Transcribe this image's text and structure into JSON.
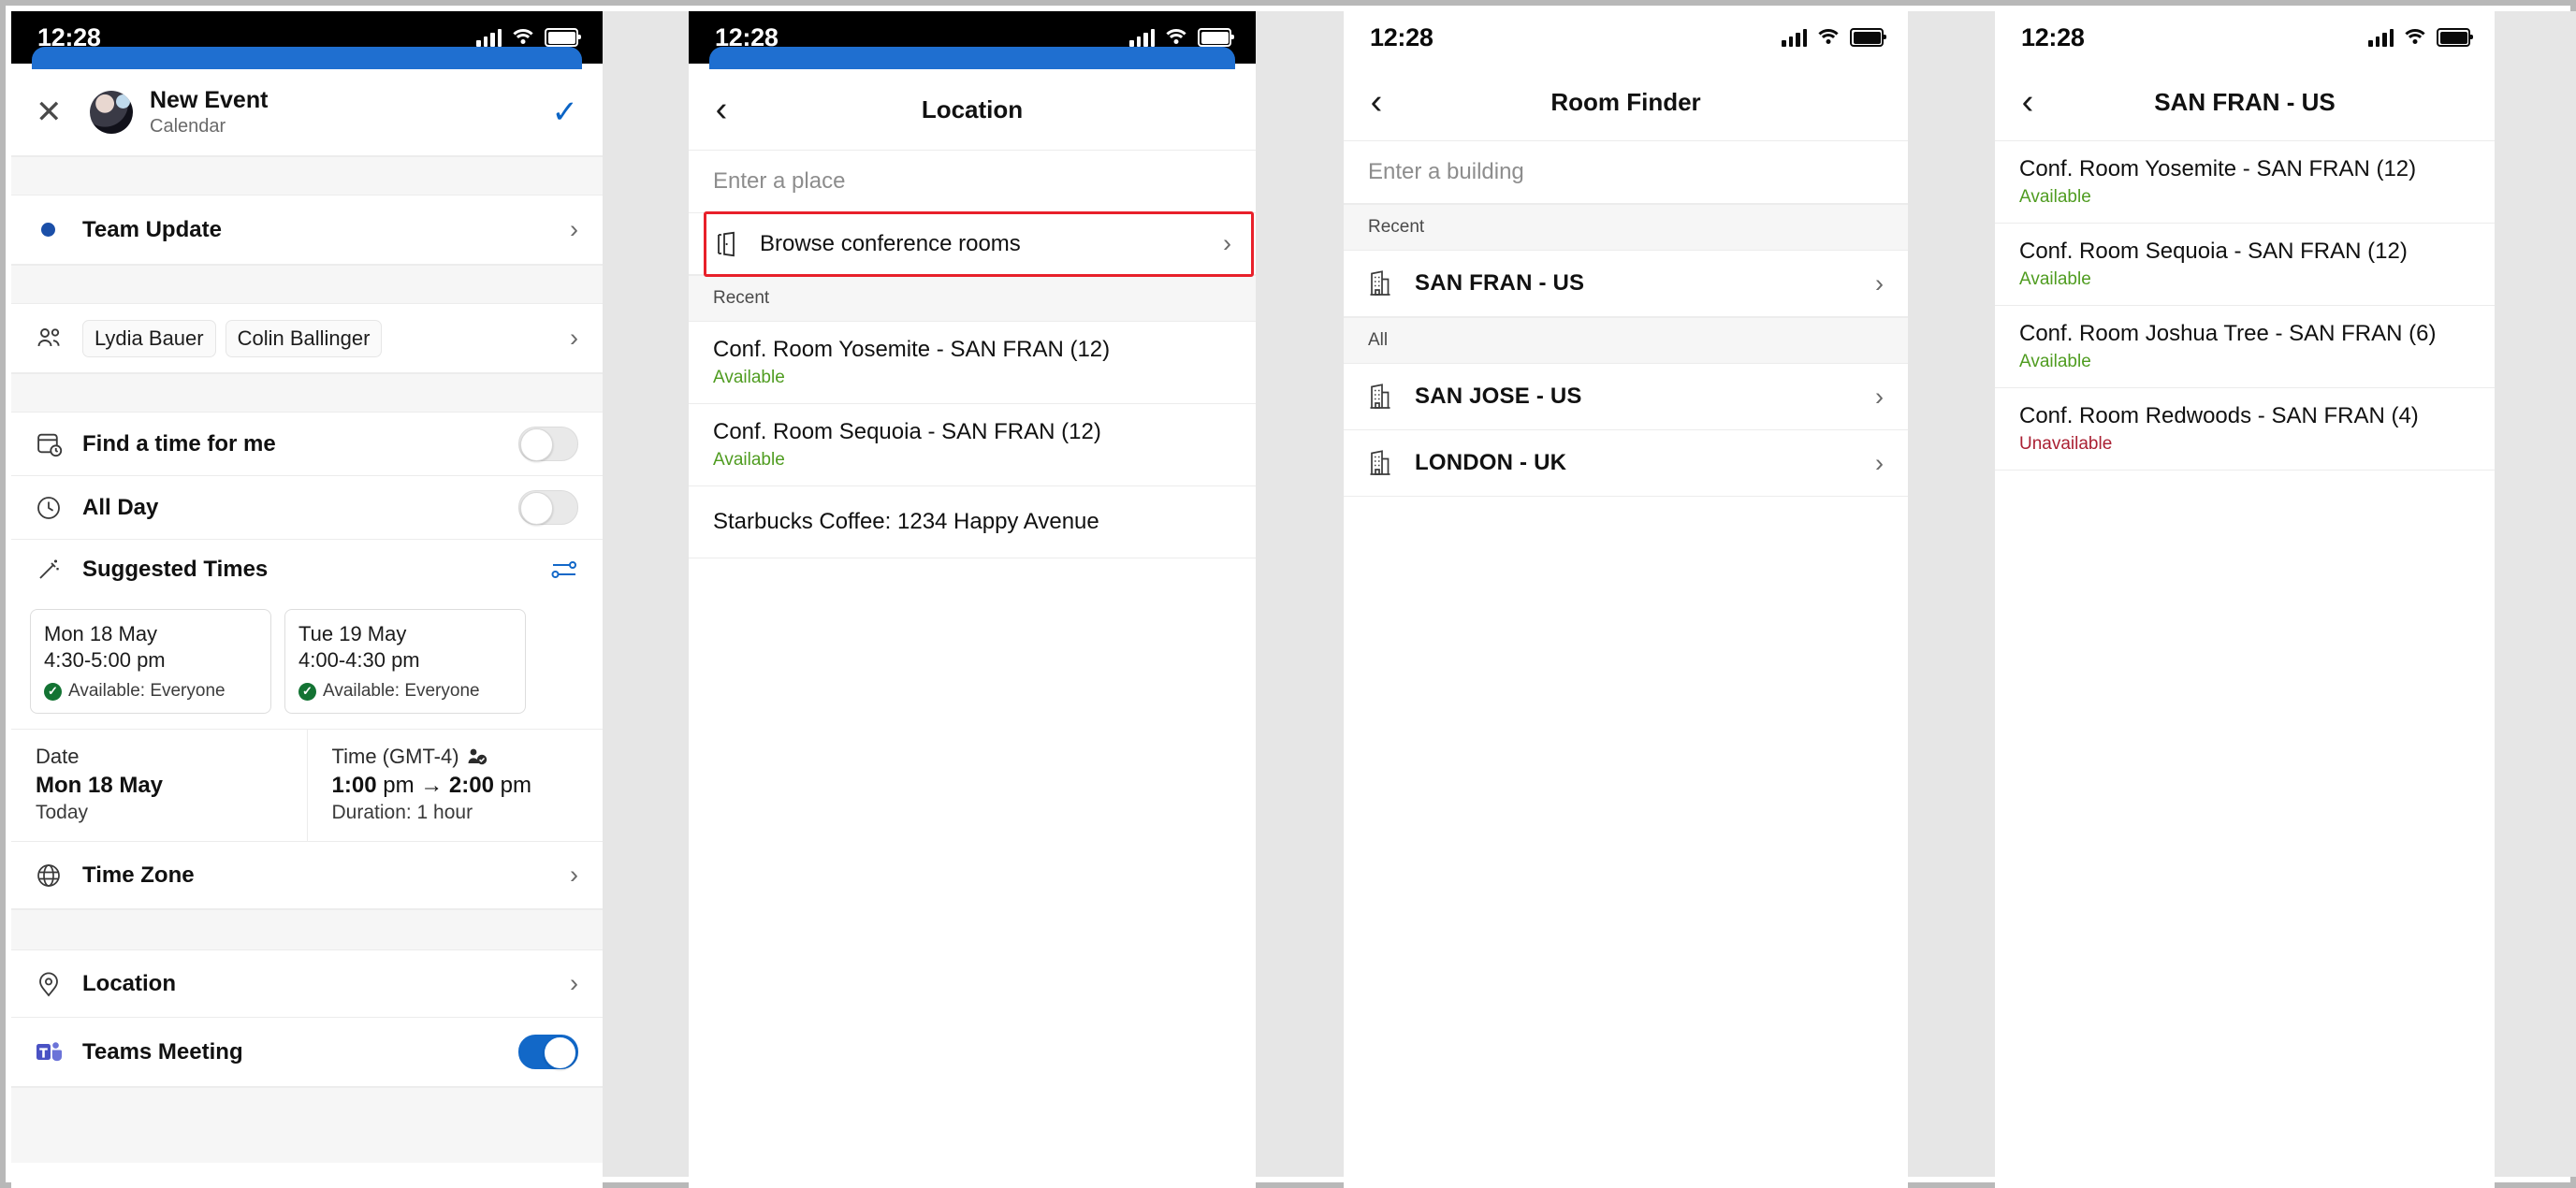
{
  "status_bar": {
    "time": "12:28",
    "icons": [
      "signal-icon",
      "wifi-icon",
      "battery-icon"
    ]
  },
  "panel_new_event": {
    "header": {
      "close_label": "✕",
      "title": "New Event",
      "subtitle": "Calendar",
      "confirm_label": "✓",
      "avatar_name": "avatar"
    },
    "title_row": {
      "label": "Team Update",
      "chevron": "›"
    },
    "people_row": {
      "attendees": [
        "Lydia Bauer",
        "Colin Ballinger"
      ],
      "chevron": "›"
    },
    "find_time_row": {
      "label": "Find a time for me",
      "toggle_state": "off"
    },
    "all_day_row": {
      "label": "All Day",
      "toggle_state": "off"
    },
    "suggested_times": {
      "label": "Suggested Times",
      "cards": [
        {
          "date": "Mon 18 May",
          "time": "4:30-5:00 pm",
          "availability": "Available: Everyone"
        },
        {
          "date": "Tue 19 May",
          "time": "4:00-4:30 pm",
          "availability": "Available: Everyone"
        }
      ]
    },
    "date_time": {
      "date_label": "Date",
      "date_value": "Mon 18 May",
      "date_sub": "Today",
      "time_label": "Time (GMT-4)",
      "time_value_start": "1:00",
      "time_value_start_suffix": " pm ",
      "time_arrow": "→",
      "time_value_end": " 2:00",
      "time_value_end_suffix": " pm",
      "duration": "Duration: 1 hour"
    },
    "time_zone_row": {
      "label": "Time Zone",
      "chevron": "›"
    },
    "location_row": {
      "label": "Location",
      "chevron": "›"
    },
    "teams_meeting_row": {
      "label": "Teams Meeting",
      "toggle_state": "on"
    }
  },
  "panel_location": {
    "nav": {
      "back": "‹",
      "title": "Location"
    },
    "search_placeholder": "Enter a place",
    "browse_rooms": {
      "label": "Browse conference rooms",
      "chevron": "›",
      "highlighted": true
    },
    "section_recent": "Recent",
    "items": [
      {
        "title": "Conf. Room Yosemite - SAN FRAN (12)",
        "status": "Available",
        "status_kind": "avail"
      },
      {
        "title": "Conf. Room Sequoia - SAN FRAN (12)",
        "status": "Available",
        "status_kind": "avail"
      },
      {
        "title": "Starbucks Coffee: 1234 Happy Avenue",
        "status": "",
        "status_kind": "none"
      }
    ]
  },
  "panel_room_finder": {
    "nav": {
      "back": "‹",
      "title": "Room Finder"
    },
    "search_placeholder": "Enter a building",
    "section_recent": "Recent",
    "recent_buildings": [
      {
        "name": "SAN FRAN - US",
        "chevron": "›"
      }
    ],
    "section_all": "All",
    "all_buildings": [
      {
        "name": "SAN JOSE - US",
        "chevron": "›"
      },
      {
        "name": "LONDON - UK",
        "chevron": "›"
      }
    ]
  },
  "panel_building_rooms": {
    "nav": {
      "back": "‹",
      "title": "SAN FRAN - US"
    },
    "rooms": [
      {
        "title": "Conf. Room Yosemite - SAN FRAN (12)",
        "status": "Available",
        "status_kind": "avail"
      },
      {
        "title": "Conf. Room Sequoia - SAN FRAN (12)",
        "status": "Available",
        "status_kind": "avail"
      },
      {
        "title": "Conf. Room Joshua Tree - SAN FRAN (6)",
        "status": "Available",
        "status_kind": "avail"
      },
      {
        "title": "Conf. Room Redwoods - SAN FRAN (4)",
        "status": "Unavailable",
        "status_kind": "unavail"
      }
    ]
  },
  "colors": {
    "accent_blue": "#1268c8",
    "available_green": "#4f9c20",
    "unavailable_red": "#aa2033",
    "highlight_red": "#e8202a",
    "header_blue": "#1f6fd0"
  }
}
